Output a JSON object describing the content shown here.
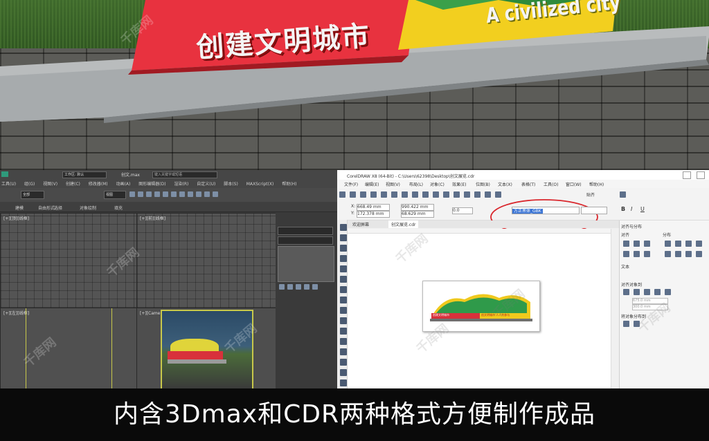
{
  "render": {
    "sign_chinese": "创建文明城市",
    "sign_english": "A civilized city"
  },
  "max": {
    "title_file": "创文.max",
    "workspace": "工作区: 默认",
    "search_placeholder": "键入关键字或短语",
    "menu_items": [
      "工具(U)",
      "组(G)",
      "视图(V)",
      "创建(C)",
      "修改器(M)",
      "动画(A)",
      "图形编辑器(D)",
      "渲染(R)",
      "自定义(U)",
      "脚本(S)",
      "MAXScript(X)",
      "帮助(H)"
    ],
    "tabs": [
      "建模",
      "自由形式",
      "选择",
      "对象绘制",
      "填充"
    ],
    "viewport_labels": [
      "[+][顶][线框]",
      "[+][前][线框]",
      "[+][左][线框]",
      "[+][Camera01][真实]"
    ],
    "selection_label": "全部",
    "view_label": "视图"
  },
  "cdr": {
    "title": "CorelDRAW X8 (64-Bit) - C:\\Users\\62398\\Desktop\\创文展览.cdr",
    "menu_items": [
      "文件(F)",
      "编辑(E)",
      "视图(V)",
      "布局(L)",
      "对象(C)",
      "效果(E)",
      "位图(B)",
      "文本(X)",
      "表格(T)",
      "工具(O)",
      "窗口(W)",
      "帮助(H)"
    ],
    "x_value": "668.49 mm",
    "y_value": "172.378 mm",
    "w_value": "990.422 mm",
    "h_value": "68.629 mm",
    "angle_value": "0.0",
    "font_name": "方正黑体_GBK",
    "snap_label": "贴齐",
    "doc_tabs": [
      "欢迎屏幕",
      "创文展览.cdr"
    ],
    "align_panel_title": "对齐与分布",
    "align_label": "对齐",
    "distribute_label": "分布",
    "text_label": "文本",
    "align_objects_to": "对齐对象到",
    "x_field": "675.0 mm",
    "y_field": "300.0 mm",
    "distribute_objects_to": "将对象分布到",
    "preview_title": "创建文明城市",
    "preview_slogan": "创文明城市 人人共参与"
  },
  "watermark": "千库网",
  "caption": "内含3Dmax和CDR两种格式方便制作成品"
}
